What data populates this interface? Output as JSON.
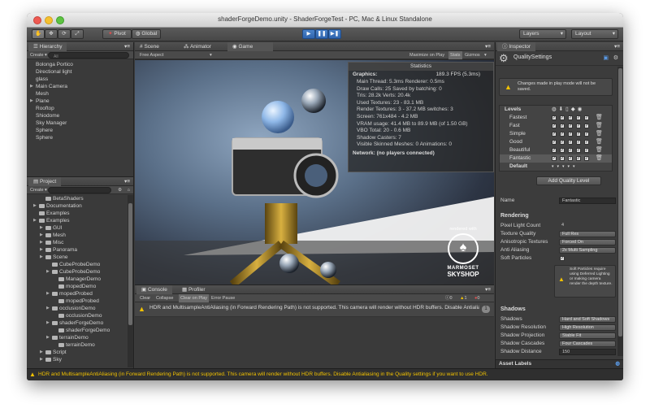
{
  "window": {
    "title": "shaderForgeDemo.unity - ShaderForgeTest - PC, Mac & Linux Standalone"
  },
  "toolbar": {
    "pivot": "Pivot",
    "global": "Global",
    "layers": "Layers",
    "layout": "Layout"
  },
  "hierarchy": {
    "tab": "Hierarchy",
    "create": "Create",
    "search_placeholder": "All",
    "items": [
      "Bolonga Portico",
      "Directional light",
      "glass",
      "Main Camera",
      "Mesh",
      "Plane",
      "Rooftop",
      "Shiodome",
      "Sky Manager",
      "Sphere",
      "Sphere"
    ]
  },
  "project": {
    "tab": "Project",
    "create": "Create",
    "items": [
      "BetaShaders",
      "Documentation",
      "Examples",
      "Examples",
      "GUI",
      "Mesh",
      "Misc",
      "Panorama",
      "Scene",
      "CubeProbeDemo",
      "CubeProbeDemo",
      "ManagerDemo",
      "mopedDemo",
      "mopedProbed",
      "mopedProbed",
      "occlusionDemo",
      "occlusionDemo",
      "shaderForgeDemo",
      "shaderForgeDemo",
      "terrainDemo",
      "terrainDemo",
      "Script",
      "Sky"
    ]
  },
  "scene_tabs": {
    "scene": "Scene",
    "animator": "Animator",
    "game": "Game",
    "aspect": "Free Aspect",
    "maximize": "Maximize on Play",
    "stats": "Stats",
    "gizmos": "Gizmos"
  },
  "stats": {
    "title": "Statistics",
    "graphics": "Graphics:",
    "fps": "189.3 FPS (5.3ms)",
    "lines": [
      "Main Thread: 5.3ms  Renderer: 0.5ms",
      "Draw Calls: 25    Saved by batching: 0",
      "Tris: 28.2k     Verts: 20.4k",
      "Used Textures: 23 - 83.1 MB",
      "Render Textures: 3 - 37.2 MB    switches: 3",
      "Screen: 761x484 - 4.2 MB",
      "VRAM usage: 41.4 MB to 89.9 MB (of 1.50 GB)",
      "VBO Total: 20 - 0.6 MB",
      "Shadow Casters: 7",
      "Visible Skinned Meshes: 0       Animations: 0"
    ],
    "network": "Network: (no players connected)"
  },
  "marmoset": {
    "rendered_with": "rendered with",
    "brand": "MARMOSET",
    "product": "SKYSHOP"
  },
  "console": {
    "tab": "Console",
    "profiler": "Profiler",
    "buttons": [
      "Clear",
      "Collapse",
      "Clear on Play",
      "Error Pause"
    ],
    "message": "HDR and MultisampleAntiAliasing (in Forward Rendering Path) is not supported. This camera will render without HDR buffers. Disable Antialiasing...",
    "warn_count": "1",
    "info_count": "0",
    "err_count": "0"
  },
  "inspector": {
    "tab": "Inspector",
    "title": "QualitySettings",
    "warning": "Changes made in play mode will not be saved.",
    "levels_label": "Levels",
    "levels": [
      "Fastest",
      "Fast",
      "Simple",
      "Good",
      "Beautiful",
      "Fantastic"
    ],
    "default_label": "Default",
    "add_button": "Add Quality Level",
    "name_label": "Name",
    "name_value": "Fantastic",
    "rendering_section": "Rendering",
    "pixel_light_label": "Pixel Light Count",
    "pixel_light_value": "4",
    "texture_quality_label": "Texture Quality",
    "texture_quality_value": "Full Res",
    "aniso_label": "Anisotropic Textures",
    "aniso_value": "Forced On",
    "aa_label": "Anti Aliasing",
    "aa_value": "2x Multi Sampling",
    "soft_particles_label": "Soft Particles",
    "soft_particles_note": "Soft Particles require using Deferred Lighting or making camera render the depth texture.",
    "shadows_section": "Shadows",
    "shadows_label": "Shadows",
    "shadows_value": "Hard and Soft Shadows",
    "shadow_res_label": "Shadow Resolution",
    "shadow_res_value": "High Resolution",
    "shadow_proj_label": "Shadow Projection",
    "shadow_proj_value": "Stable Fit",
    "shadow_casc_label": "Shadow Cascades",
    "shadow_casc_value": "Four Cascades",
    "shadow_dist_label": "Shadow Distance",
    "shadow_dist_value": "150",
    "asset_labels": "Asset Labels"
  },
  "statusbar": {
    "message": "HDR and MultisampleAntiAliasing (in Forward Rendering Path) is not supported. This camera will render without HDR buffers. Disable Antialiasing in the Quality settings if you want to use HDR."
  },
  "colors": {
    "accent": "#3a78c8",
    "warning": "#f2c200",
    "panel": "#3d3d3d"
  }
}
